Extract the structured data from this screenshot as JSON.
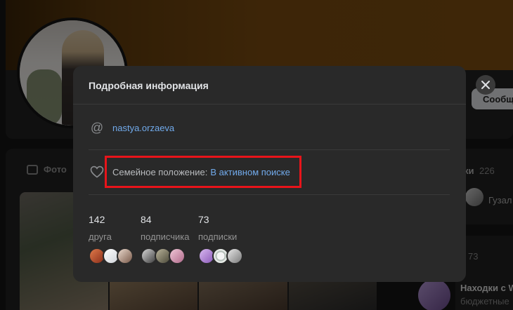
{
  "background": {
    "photos_tab": "Фото",
    "friends_title": "ки",
    "friends_count": "226",
    "friend_name": "Гузал",
    "subs_count": "73",
    "sub_name": "Находки с W",
    "sub_desc": "бюджетные",
    "message_button": "Сообщ"
  },
  "modal": {
    "title": "Подробная информация",
    "username": "nastya.orzaeva",
    "family_label": "Семейное положение: ",
    "family_value": "В активном поиске",
    "stats": [
      {
        "value": "142",
        "label": "друга"
      },
      {
        "value": "84",
        "label": "подписчика"
      },
      {
        "value": "73",
        "label": "подписки"
      }
    ]
  },
  "icons": {
    "username": "at-icon",
    "family": "heart-icon",
    "close": "close-icon"
  },
  "colors": {
    "link": "#71aaeb",
    "highlight": "#e8141a",
    "modal_bg": "#292929"
  }
}
